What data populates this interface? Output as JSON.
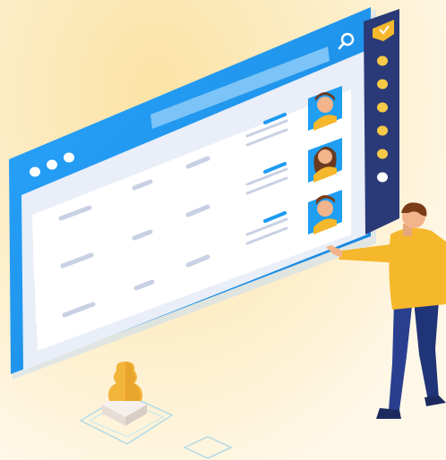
{
  "window": {
    "title_dots": 3,
    "search_placeholder": ""
  },
  "sidebar": {
    "nav_dots": 7,
    "active_index": 6
  },
  "rows": [
    {
      "avatar": "male-avatar",
      "has_lines": true
    },
    {
      "avatar": "female-avatar",
      "has_lines": true
    },
    {
      "avatar": "male-avatar",
      "has_lines": true
    }
  ],
  "colors": {
    "accent": "#1e9bf0",
    "window_frame": "#1e9bf0",
    "sidebar": "#2a3a78",
    "avatar_bg": "#1f9ef2",
    "nav_dot": "#f7c948",
    "person_shirt": "#f5b72b",
    "person_pants": "#2a3f8f",
    "chess_piece": "#f3b43a"
  }
}
